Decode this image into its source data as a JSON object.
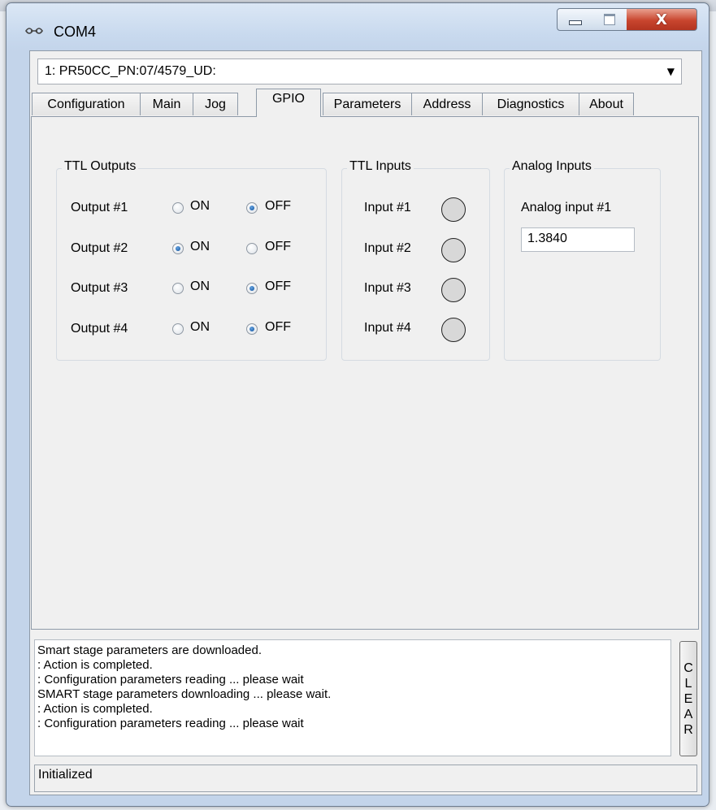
{
  "window": {
    "title": "COM4",
    "icon": "link-icon",
    "title_icon_glyph": "ᯅ"
  },
  "controls": {
    "close_glyph": "X"
  },
  "device": {
    "selected": "1: PR50CC_PN:07/4579_UD:",
    "arrow": "▼"
  },
  "tabs": [
    {
      "label": "Configuration"
    },
    {
      "label": "Main"
    },
    {
      "label": "Jog"
    },
    {
      "label": "GPIO"
    },
    {
      "label": "Parameters"
    },
    {
      "label": "Address"
    },
    {
      "label": "Diagnostics"
    },
    {
      "label": "About"
    }
  ],
  "active_tab": "GPIO",
  "ttl_outputs": {
    "title": "TTL Outputs",
    "on_label": "ON",
    "off_label": "OFF",
    "rows": [
      {
        "label": "Output #1",
        "state": "OFF"
      },
      {
        "label": "Output #2",
        "state": "ON"
      },
      {
        "label": "Output #3",
        "state": "OFF"
      },
      {
        "label": "Output #4",
        "state": "OFF"
      }
    ]
  },
  "ttl_inputs": {
    "title": "TTL Inputs",
    "rows": [
      {
        "label": "Input #1"
      },
      {
        "label": "Input #2"
      },
      {
        "label": "Input #3"
      },
      {
        "label": "Input #4"
      }
    ],
    "led_color": "#d8d8d8"
  },
  "analog_inputs": {
    "title": "Analog Inputs",
    "label": "Analog input #1",
    "value": "1.3840"
  },
  "log": {
    "lines": [
      "Smart stage parameters are downloaded.",
      ": Action is completed.",
      ": Configuration parameters reading ... please wait",
      "SMART stage parameters downloading ... please wait.",
      ": Action is completed.",
      ": Configuration parameters reading ... please wait"
    ]
  },
  "clear_button": {
    "letters": [
      "C",
      "L",
      "E",
      "A",
      "R"
    ]
  },
  "status": {
    "text": "Initialized"
  },
  "colors": {
    "accent": "#0b4f9c",
    "close_button": "#c8452e",
    "window_frame": "#c3d4ea"
  }
}
